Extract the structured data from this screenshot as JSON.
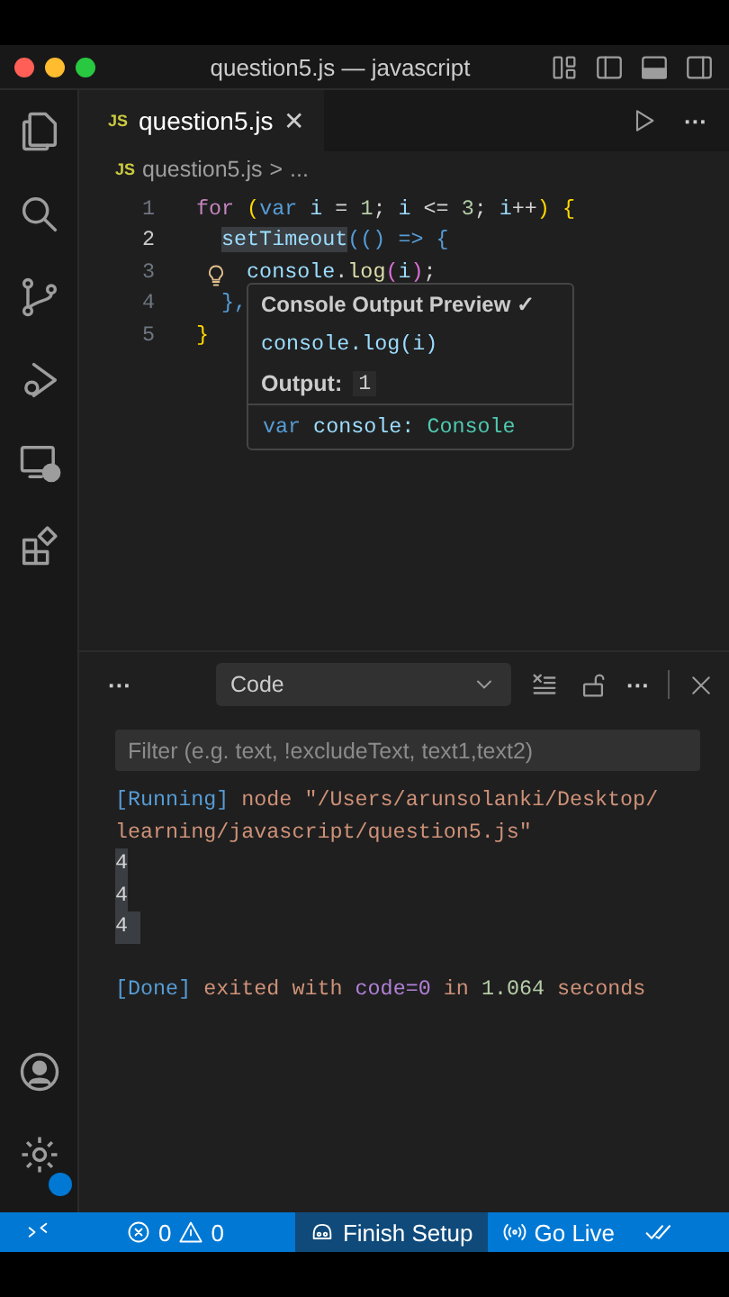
{
  "window": {
    "title": "question5.js — javascript"
  },
  "editor": {
    "tabs": [
      {
        "icon_text": "JS",
        "label": "question5.js",
        "close": "✕",
        "selected": true
      }
    ],
    "more_actions": "···",
    "breadcrumb": {
      "icon_text": "JS",
      "file": "question5.js",
      "separator": ">",
      "rest": "..."
    },
    "lines": [
      {
        "number": "1",
        "current": false,
        "tokens": [
          {
            "text": "for",
            "kind": "control"
          },
          {
            "text": " (",
            "kind": "bracket"
          },
          {
            "text": "var",
            "kind": "keyword"
          },
          {
            "text": " i ",
            "kind": "variable"
          },
          {
            "text": "=",
            "kind": "plain"
          },
          {
            "text": " 1",
            "kind": "number"
          },
          {
            "text": "; ",
            "kind": "plain"
          },
          {
            "text": "i ",
            "kind": "variable"
          },
          {
            "text": "<=",
            "kind": "plain"
          },
          {
            "text": " 3",
            "kind": "number"
          },
          {
            "text": "; ",
            "kind": "plain"
          },
          {
            "text": "i",
            "kind": "variable"
          },
          {
            "text": "++",
            "kind": "plain"
          },
          {
            "text": ")",
            "kind": "bracket"
          },
          {
            "text": " {",
            "kind": "bracket"
          }
        ]
      },
      {
        "number": "2",
        "current": true,
        "tokens": [
          {
            "text": "  setTimeout",
            "kind": "highlight"
          },
          {
            "text": "(() => {",
            "kind": "keyword"
          }
        ]
      },
      {
        "number": "3",
        "current": false,
        "tokens": [
          {
            "text": "    console",
            "kind": "variable"
          },
          {
            "text": ".",
            "kind": "plain"
          },
          {
            "text": "log",
            "kind": "function"
          },
          {
            "text": "(",
            "kind": "bracket2"
          },
          {
            "text": "i",
            "kind": "variable"
          },
          {
            "text": ")",
            "kind": "bracket2"
          },
          {
            "text": ";",
            "kind": "plain"
          }
        ]
      },
      {
        "number": "4",
        "current": false,
        "tokens": [
          {
            "text": "  },",
            "kind": "keyword"
          }
        ]
      },
      {
        "number": "5",
        "current": false,
        "tokens": [
          {
            "text": "}",
            "kind": "bracket"
          }
        ]
      }
    ],
    "hover": {
      "title": "Console Output Preview ✓",
      "code": "console.log(i)",
      "output_label": "Output:",
      "output_value": "1",
      "declaration": [
        {
          "text": "var",
          "kind": "keyword"
        },
        {
          "text": " console: ",
          "kind": "variable"
        },
        {
          "text": "Console",
          "kind": "type"
        }
      ]
    }
  },
  "panel": {
    "more": "···",
    "dropdown": "Code",
    "more_actions": "···",
    "filter_placeholder": "Filter (e.g. text, !excludeText, text1,text2)",
    "output": [
      {
        "selected": false,
        "tokens": [
          {
            "text": "[Running]",
            "kind": "info"
          },
          {
            "text": " node \"/Users/arunsolanki/Desktop/",
            "kind": "string"
          }
        ]
      },
      {
        "selected": false,
        "tokens": [
          {
            "text": "learning/javascript/question5.js\"",
            "kind": "string"
          }
        ]
      },
      {
        "selected": true,
        "tokens": [
          {
            "text": "4",
            "kind": "plain"
          }
        ]
      },
      {
        "selected": true,
        "tokens": [
          {
            "text": "4",
            "kind": "plain"
          }
        ]
      },
      {
        "selected": true,
        "tokens": [
          {
            "text": "4 ",
            "kind": "plain"
          }
        ]
      },
      {
        "selected": false,
        "tokens": [
          {
            "text": "[Done]",
            "kind": "info"
          },
          {
            "text": " exited with ",
            "kind": "string"
          },
          {
            "text": "code=0",
            "kind": "purple"
          },
          {
            "text": " in ",
            "kind": "string"
          },
          {
            "text": "1.064",
            "kind": "number"
          },
          {
            "text": " seconds",
            "kind": "string"
          }
        ]
      }
    ]
  },
  "status_bar": {
    "items": [
      {
        "kind": "remote"
      },
      {
        "kind": "problems",
        "errors": "0",
        "warnings": "0"
      },
      {
        "kind": "copilot",
        "label": "Finish Setup"
      },
      {
        "kind": "live",
        "label": "Go Live"
      },
      {
        "kind": "checks"
      }
    ]
  }
}
